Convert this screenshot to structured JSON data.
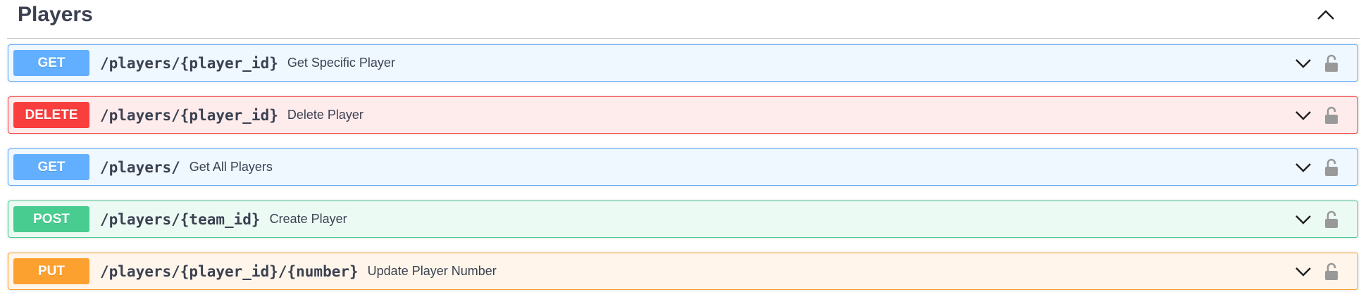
{
  "section": {
    "title": "Players"
  },
  "operations": [
    {
      "method": "GET",
      "path": "/players/{player_id}",
      "summary": "Get Specific Player"
    },
    {
      "method": "DELETE",
      "path": "/players/{player_id}",
      "summary": "Delete Player"
    },
    {
      "method": "GET",
      "path": "/players/",
      "summary": "Get All Players"
    },
    {
      "method": "POST",
      "path": "/players/{team_id}",
      "summary": "Create Player"
    },
    {
      "method": "PUT",
      "path": "/players/{player_id}/{number}",
      "summary": "Update Player Number"
    }
  ],
  "icons": {
    "collapse": "chevron-up-icon",
    "expand": "chevron-down-icon",
    "auth": "unlocked-padlock-icon"
  },
  "colors": {
    "get": "#61affe",
    "delete": "#f93e3e",
    "post": "#49cc90",
    "put": "#fca130",
    "text": "#3b4151"
  }
}
